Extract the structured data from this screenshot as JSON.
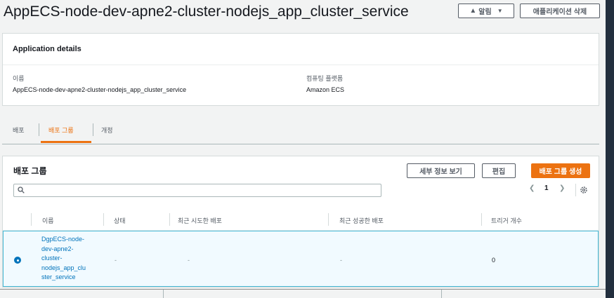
{
  "header": {
    "title": "AppECS-node-dev-apne2-cluster-nodejs_app_cluster_service",
    "notify_label": "알림",
    "delete_label": "애플리케이션 삭제"
  },
  "details": {
    "heading": "Application details",
    "name_label": "이름",
    "name_value": "AppECS-node-dev-apne2-cluster-nodejs_app_cluster_service",
    "platform_label": "컴퓨팅 플랫폼",
    "platform_value": "Amazon ECS"
  },
  "tabs": [
    {
      "label": "배포",
      "active": false
    },
    {
      "label": "배포 그룹",
      "active": true
    },
    {
      "label": "개정",
      "active": false
    }
  ],
  "groups": {
    "title": "배포 그룹",
    "view_details_label": "세부 정보 보기",
    "edit_label": "편집",
    "create_label": "배포 그룹 생성",
    "search_placeholder": "",
    "page": "1",
    "columns": [
      "이름",
      "상태",
      "최근 시도한 배포",
      "최근 성공한 배포",
      "트리거 개수"
    ],
    "rows": [
      {
        "name_lines": [
          "DgpECS-node-",
          "dev-apne2-",
          "cluster-",
          "nodejs_app_clu",
          "ster_service"
        ],
        "status": "-",
        "last_attempted": "-",
        "last_succeeded": "-",
        "trigger_count": "0",
        "selected": true
      }
    ]
  },
  "icons": {
    "bell": "bell-icon",
    "caret": "caret-down-icon",
    "search": "search-icon",
    "prev": "chevron-left-icon",
    "next": "chevron-right-icon",
    "settings": "gear-icon"
  },
  "colors": {
    "accent": "#ec7211",
    "link": "#0073bb",
    "selected_border": "#44b9d6"
  }
}
